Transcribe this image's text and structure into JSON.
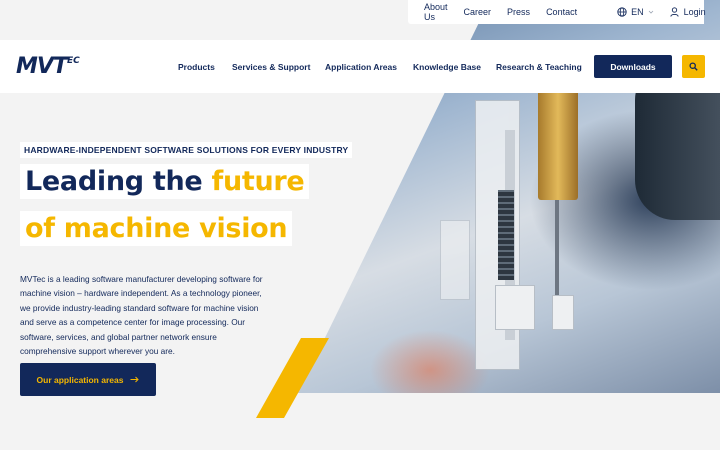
{
  "utility": {
    "links": [
      "About Us",
      "Career",
      "Press",
      "Contact"
    ],
    "language": "EN",
    "login": "Login"
  },
  "logo": {
    "main": "MVT",
    "suffix": "EC"
  },
  "nav": {
    "items": [
      "Products",
      "Services & Support",
      "Application Areas",
      "Knowledge Base",
      "Research & Teaching"
    ],
    "downloads": "Downloads"
  },
  "hero": {
    "eyebrow": "HARDWARE-INDEPENDENT SOFTWARE SOLUTIONS FOR EVERY INDUSTRY",
    "headline_part1": "Leading the ",
    "headline_highlight": "future",
    "headline_line2": "of machine vision",
    "body": "MVTec is a leading software manufacturer developing software for machine vision – hardware independent. As a technology pioneer, we provide industry-leading standard software for machine vision and serve as a competence center for image processing. Our software, services, and global partner network ensure comprehensive support wherever you are.",
    "cta": "Our application areas"
  },
  "colors": {
    "navy": "#12285a",
    "yellow": "#f5b700",
    "background": "#f3f3f3"
  },
  "icons": {
    "globe": "globe-icon",
    "user": "user-icon",
    "search": "search-icon",
    "arrow": "arrow-right-icon",
    "chevron": "chevron-down-icon"
  }
}
